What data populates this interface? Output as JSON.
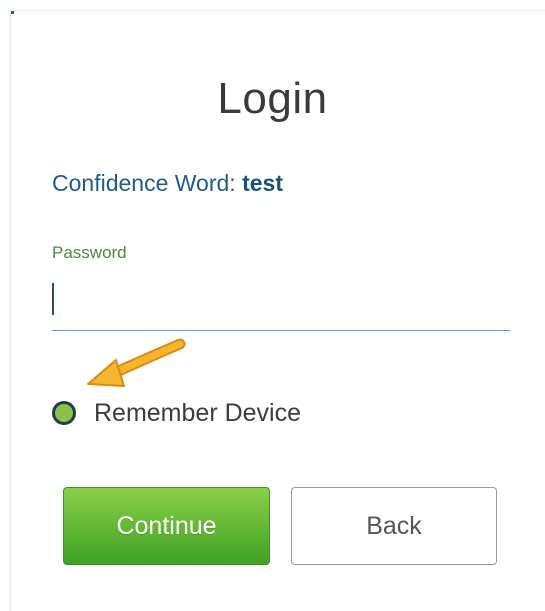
{
  "login": {
    "title": "Login",
    "confidence_label": "Confidence Word:",
    "confidence_word": "test",
    "password_label": "Password",
    "password_value": "",
    "remember_label": "Remember Device",
    "remember_checked": true,
    "continue_label": "Continue",
    "back_label": "Back"
  },
  "colors": {
    "accent_green": "#4caf2f",
    "link_blue": "#1f5c8a",
    "arrow_orange": "#f5a623"
  },
  "annotation": {
    "arrow_icon": "pointer-arrow-icon"
  }
}
